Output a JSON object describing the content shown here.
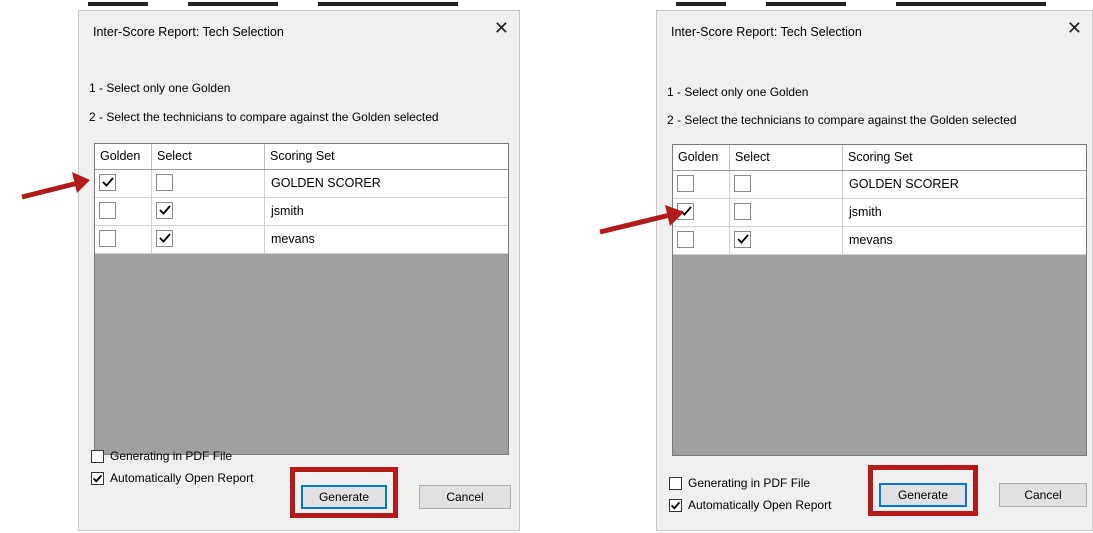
{
  "left_dialog": {
    "title": "Inter-Score Report: Tech Selection",
    "instruction1": "1 - Select only one Golden",
    "instruction2": "2 - Select the technicians to compare against the Golden selected",
    "columns": [
      "Golden",
      "Select",
      "Scoring Set"
    ],
    "rows": [
      {
        "golden": true,
        "select": false,
        "name": "GOLDEN SCORER"
      },
      {
        "golden": false,
        "select": true,
        "name": "jsmith"
      },
      {
        "golden": false,
        "select": true,
        "name": "mevans"
      }
    ],
    "pdf_option": {
      "label": "Generating in PDF File",
      "checked": false
    },
    "auto_open_option": {
      "label": "Automatically Open Report",
      "checked": true
    },
    "generate_label": "Generate",
    "cancel_label": "Cancel"
  },
  "right_dialog": {
    "title": "Inter-Score Report: Tech Selection",
    "instruction1": "1 - Select only one Golden",
    "instruction2": "2 - Select the technicians to compare against the Golden selected",
    "columns": [
      "Golden",
      "Select",
      "Scoring Set"
    ],
    "rows": [
      {
        "golden": false,
        "select": false,
        "name": "GOLDEN SCORER"
      },
      {
        "golden": true,
        "select": false,
        "name": "jsmith"
      },
      {
        "golden": false,
        "select": true,
        "name": "mevans"
      }
    ],
    "pdf_option": {
      "label": "Generating in PDF File",
      "checked": false
    },
    "auto_open_option": {
      "label": "Automatically Open Report",
      "checked": true
    },
    "generate_label": "Generate",
    "cancel_label": "Cancel"
  },
  "colors": {
    "highlight": "#b31b1b",
    "grid_empty": "#a0a0a0",
    "focus_border": "#0078d7"
  },
  "icons": {
    "close": "close-icon",
    "check": "checkmark-icon",
    "annotation": "red-arrow"
  }
}
